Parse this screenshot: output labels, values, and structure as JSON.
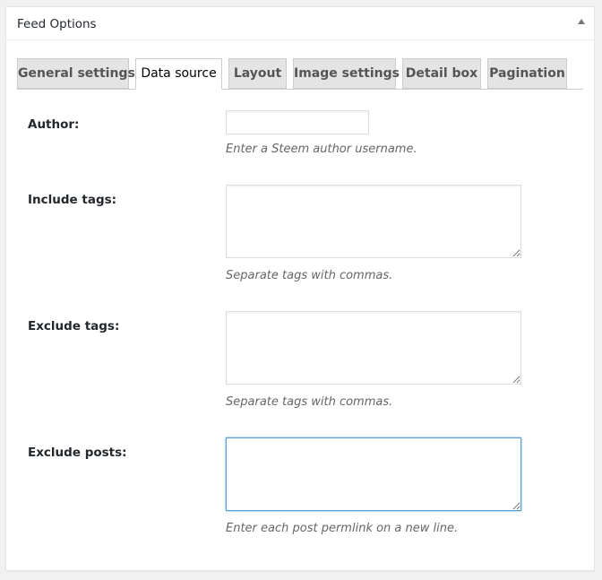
{
  "panel": {
    "title": "Feed Options"
  },
  "tabs": [
    {
      "label": "General settings",
      "active": false
    },
    {
      "label": "Data source",
      "active": true
    },
    {
      "label": "Layout",
      "active": false
    },
    {
      "label": "Image settings",
      "active": false
    },
    {
      "label": "Detail box",
      "active": false
    },
    {
      "label": "Pagination",
      "active": false
    }
  ],
  "fields": {
    "author": {
      "label": "Author:",
      "value": "",
      "description": "Enter a Steem author username."
    },
    "include_tags": {
      "label": "Include tags:",
      "value": "",
      "description": "Separate tags with commas."
    },
    "exclude_tags": {
      "label": "Exclude tags:",
      "value": "",
      "description": "Separate tags with commas."
    },
    "exclude_posts": {
      "label": "Exclude posts:",
      "value": "",
      "description": "Enter each post permlink on a new line."
    }
  },
  "colors": {
    "focus_border": "#5b9dd9",
    "active_tab_bg": "#ffffff",
    "inactive_tab_bg": "#e4e4e4",
    "page_bg": "#f1f1f1"
  }
}
